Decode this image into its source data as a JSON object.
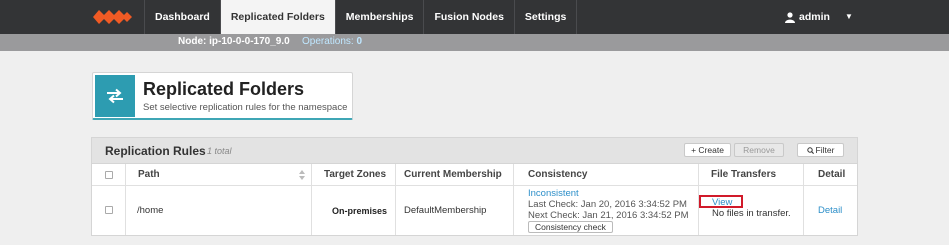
{
  "nav": {
    "tabs": [
      {
        "label": "Dashboard"
      },
      {
        "label": "Replicated Folders"
      },
      {
        "label": "Memberships"
      },
      {
        "label": "Fusion Nodes"
      },
      {
        "label": "Settings"
      }
    ],
    "active_tab": "Replicated Folders",
    "user": "admin",
    "brand_color": "#f15a24"
  },
  "status": {
    "node_label": "Node: ip-10-0-0-170_9.0",
    "operations_label": "Operations:",
    "operations_count": "0"
  },
  "header": {
    "title": "Replicated Folders",
    "subtitle": "Set selective replication rules for the namespace",
    "icon": "swap-arrows-icon",
    "accent": "#2d9cb1"
  },
  "panel": {
    "title": "Replication Rules",
    "count_label": "1 total",
    "create_label": "+ Create",
    "remove_label": "Remove",
    "filter_label": "Filter"
  },
  "table": {
    "columns": [
      "Path",
      "Target Zones",
      "Current Membership",
      "Consistency",
      "File Transfers",
      "Detail"
    ],
    "rows": [
      {
        "path": "/home",
        "target_zones": "On-premises",
        "membership": "DefaultMembership",
        "consistency_status": "Inconsistent",
        "last_check": "Last Check: Jan 20, 2016 3:34:52 PM",
        "next_check": "Next Check: Jan 21, 2016 3:34:52 PM",
        "consistency_button": "Consistency check",
        "view_label": "View",
        "transfer_status": "No files in transfer.",
        "detail_label": "Detail"
      }
    ]
  }
}
